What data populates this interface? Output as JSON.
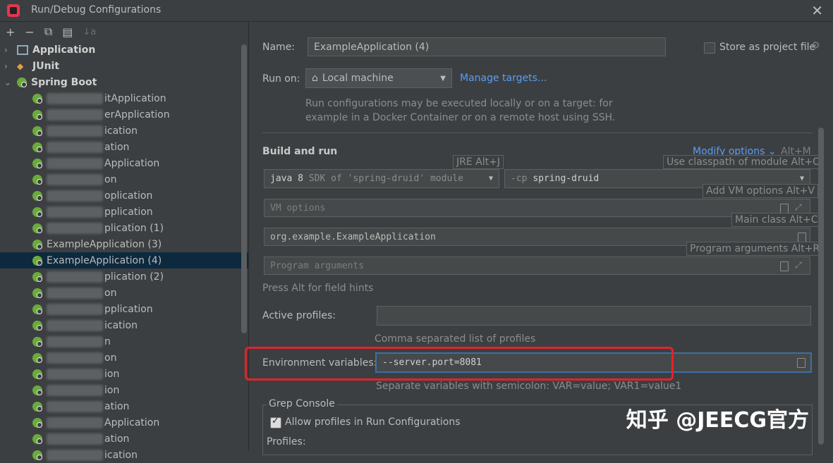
{
  "window": {
    "title": "Run/Debug Configurations",
    "close_glyph": "✕"
  },
  "toolbar": {
    "add": "+",
    "remove": "−",
    "copy": "⧉",
    "folder": "▤",
    "sort": "↓a"
  },
  "tree": {
    "groups": [
      {
        "label": "Application",
        "expanded": false,
        "icon": "application-icon"
      },
      {
        "label": "JUnit",
        "expanded": false,
        "icon": "junit-icon"
      },
      {
        "label": "Spring Boot",
        "expanded": true,
        "icon": "spring-boot-icon"
      }
    ],
    "items": [
      "itApplication",
      "erApplication",
      "ication",
      "ation",
      "Application",
      "on",
      "oplication",
      "pplication",
      "plication (1)",
      "ExampleApplication (3)",
      "ExampleApplication (4)",
      "plication (2)",
      "on",
      "pplication",
      "ication",
      "n",
      "on",
      "ion",
      "ion",
      "ation",
      "Application",
      "ation",
      "ication"
    ],
    "selected_index": 10
  },
  "form": {
    "name_label": "Name:",
    "name_value": "ExampleApplication (4)",
    "store_label": "Store as project file",
    "run_on_label": "Run on:",
    "run_on_value": "Local machine",
    "manage_targets": "Manage targets...",
    "run_on_hint_1": "Run configurations may be executed locally or on a target: for",
    "run_on_hint_2": "example in a Docker Container or on a remote host using SSH.",
    "build_run_title": "Build and run",
    "modify_options": "Modify options",
    "modify_shortcut": "Alt+M",
    "jre_value_prefix": "java 8",
    "jre_value_suffix": "SDK of 'spring-druid' module",
    "classpath_value_prefix": "-cp",
    "classpath_value": "spring-druid",
    "vm_options_placeholder": "VM options",
    "main_class_value": "org.example.ExampleApplication",
    "program_args_placeholder": "Program arguments",
    "field_hints": "Press Alt for field hints",
    "active_profiles_label": "Active profiles:",
    "active_profiles_value": "",
    "profiles_hint": "Comma separated list of profiles",
    "env_label": "Environment variables:",
    "env_value": "--server.port=8081",
    "env_hint": "Separate variables with semicolon: VAR=value; VAR1=value1",
    "grep_console_title": "Grep Console",
    "allow_profiles_label": "Allow profiles in Run Configurations",
    "profiles_label": "Profiles:"
  },
  "tooltips": {
    "jre": "JRE Alt+J",
    "classpath": "Use classpath of module Alt+O",
    "vm": "Add VM options Alt+V",
    "main": "Main class Alt+C",
    "args": "Program arguments Alt+R"
  },
  "watermark": "知乎 @JEECG官方",
  "colors": {
    "background": "#3c3f41",
    "selection": "#0d293e",
    "link": "#589df6",
    "highlight_box": "#e5222a",
    "spring_green": "#6aab3b"
  }
}
